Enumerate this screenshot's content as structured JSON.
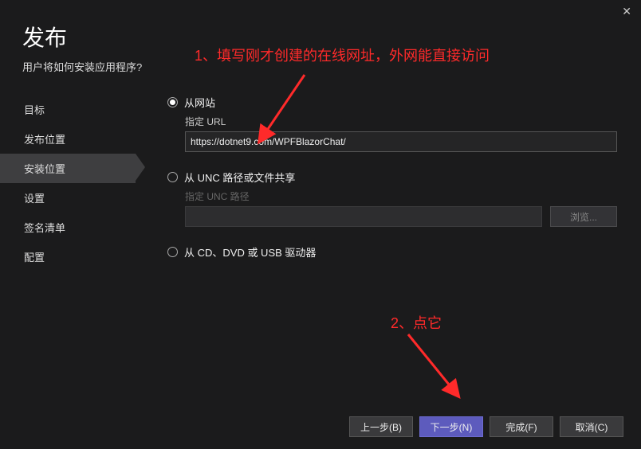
{
  "close": "✕",
  "header": {
    "title": "发布",
    "subtitle": "用户将如何安装应用程序?"
  },
  "sidebar": {
    "items": [
      {
        "label": "目标"
      },
      {
        "label": "发布位置"
      },
      {
        "label": "安装位置"
      },
      {
        "label": "设置"
      },
      {
        "label": "签名清单"
      },
      {
        "label": "配置"
      }
    ]
  },
  "options": {
    "website": {
      "label": "从网站",
      "field_label": "指定 URL",
      "value": "https://dotnet9.com/WPFBlazorChat/"
    },
    "unc": {
      "label": "从 UNC 路径或文件共享",
      "field_label": "指定 UNC 路径",
      "browse": "浏览..."
    },
    "media": {
      "label": "从 CD、DVD 或 USB 驱动器"
    }
  },
  "footer": {
    "back": "上一步(B)",
    "next": "下一步(N)",
    "finish": "完成(F)",
    "cancel": "取消(C)"
  },
  "annotations": {
    "a1": "1、填写刚才创建的在线网址，外网能直接访问",
    "a2": "2、点它"
  }
}
